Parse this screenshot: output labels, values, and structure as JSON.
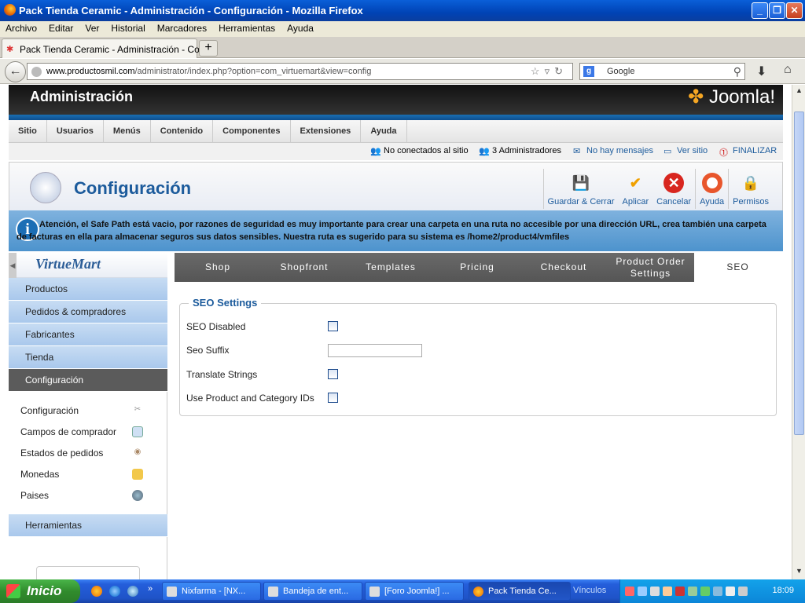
{
  "window": {
    "title": "Pack Tienda Ceramic - Administración - Configuración - Mozilla Firefox"
  },
  "menubar": [
    "Archivo",
    "Editar",
    "Ver",
    "Historial",
    "Marcadores",
    "Herramientas",
    "Ayuda"
  ],
  "tab": {
    "label": "Pack Tienda Ceramic - Administración - Confi...",
    "new_tab": "+"
  },
  "nav": {
    "url_domain": "www.productosmil.com",
    "url_path": "/administrator/index.php?option=com_virtuemart&view=config",
    "search_placeholder": "Google"
  },
  "joomla": {
    "header_title": "Administración",
    "logo_text": "Joomla!",
    "menu": [
      "Sitio",
      "Usuarios",
      "Menús",
      "Contenido",
      "Componentes",
      "Extensiones",
      "Ayuda"
    ],
    "status": {
      "offline": "No conectados al sitio",
      "admins": "3 Administradores",
      "messages": "No hay mensajes",
      "view_site": "Ver sitio",
      "logout": "FINALIZAR"
    }
  },
  "toolbar": {
    "title": "Configuración",
    "buttons": [
      "Guardar & Cerrar",
      "Aplicar",
      "Cancelar",
      "Ayuda",
      "Permisos"
    ]
  },
  "notice": "Atención, el Safe Path está vacio, por razones de seguridad es muy importante para crear una carpeta en una ruta no accesible por una dirección URL, crea también una carpeta de facturas en ella para almacenar seguros sus datos sensibles. Nuestra ruta es sugerido para su sistema es /home2/product4/vmfiles",
  "sidebar": {
    "logo_text": "VirtueMart",
    "sections": [
      "Productos",
      "Pedidos & compradores",
      "Fabricantes",
      "Tienda",
      "Configuración"
    ],
    "active_section": "Configuración",
    "sub_items": [
      "Configuración",
      "Campos de comprador",
      "Estados de pedidos",
      "Monedas",
      "Paises"
    ],
    "tools": "Herramientas"
  },
  "tabs": [
    "Shop",
    "Shopfront",
    "Templates",
    "Pricing",
    "Checkout",
    "Product Order Settings",
    "SEO"
  ],
  "active_tab": "SEO",
  "seo": {
    "legend": "SEO Settings",
    "fields": [
      {
        "label": "SEO Disabled",
        "type": "checkbox",
        "checked": false
      },
      {
        "label": "Seo Suffix",
        "type": "text",
        "value": ""
      },
      {
        "label": "Translate Strings",
        "type": "checkbox",
        "checked": false
      },
      {
        "label": "Use Product and Category IDs",
        "type": "checkbox",
        "checked": false
      }
    ]
  },
  "taskbar": {
    "start": "Inicio",
    "tasks": [
      "Nixfarma - [NX...",
      "Bandeja de ent...",
      "[Foro Joomla!] ...",
      "Pack Tienda Ce..."
    ],
    "links": "Vínculos",
    "clock": "18:09"
  },
  "colors": {
    "joomla_blue": "#1c5b9c",
    "nav_bg": "#a9c8ec",
    "active_bg": "#5b5b5b",
    "notice_bg": "#5a9ad2"
  }
}
